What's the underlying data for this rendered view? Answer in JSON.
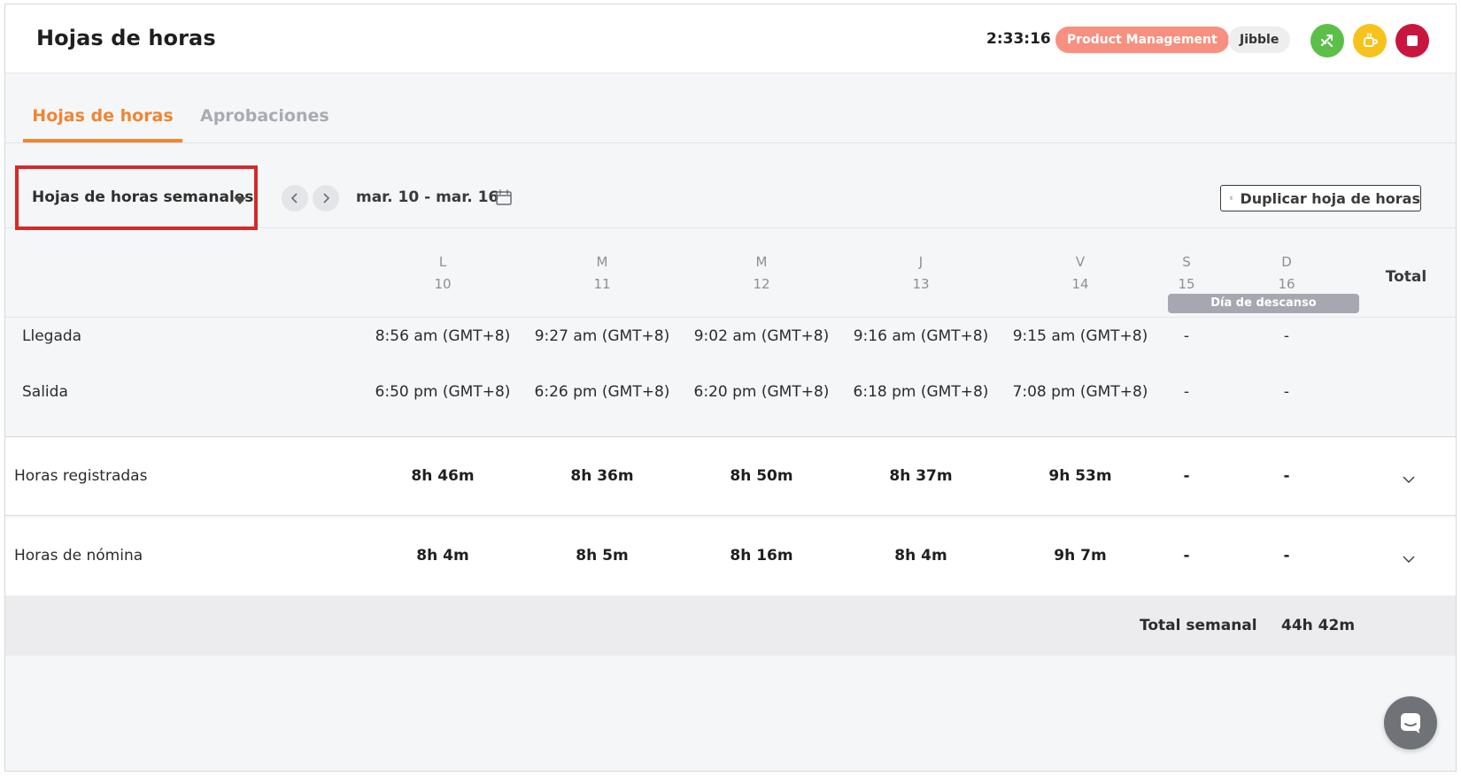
{
  "header": {
    "title": "Hojas de horas",
    "timer": "2:33:16",
    "project_badge": "Product Management",
    "org_badge": "Jibble",
    "actions": [
      "switch-icon",
      "coffee-break-icon",
      "stop-icon"
    ],
    "colors": {
      "switch": "#5cbf4a",
      "break": "#f7c21b",
      "stop": "#c8173e",
      "project_badge": "#f79080"
    }
  },
  "tabs": [
    {
      "label": "Hojas de horas",
      "active": true
    },
    {
      "label": "Aprobaciones",
      "active": false
    }
  ],
  "toolbar": {
    "view_selector": "Hojas de horas semanales",
    "date_range": "mar. 10 - mar. 16",
    "duplicate_label": "Duplicar hoja de horas"
  },
  "days": [
    {
      "letter": "L",
      "num": "10"
    },
    {
      "letter": "M",
      "num": "11"
    },
    {
      "letter": "M",
      "num": "12"
    },
    {
      "letter": "J",
      "num": "13"
    },
    {
      "letter": "V",
      "num": "14"
    },
    {
      "letter": "S",
      "num": "15"
    },
    {
      "letter": "D",
      "num": "16"
    }
  ],
  "total_header": "Total",
  "rest_day_label": "Día de descanso",
  "rows": {
    "arrival": {
      "label": "Llegada",
      "values": [
        "8:56 am (GMT+8)",
        "9:27 am (GMT+8)",
        "9:02 am (GMT+8)",
        "9:16 am (GMT+8)",
        "9:15 am (GMT+8)",
        "-",
        "-"
      ]
    },
    "departure": {
      "label": "Salida",
      "values": [
        "6:50 pm (GMT+8)",
        "6:26 pm (GMT+8)",
        "6:20 pm (GMT+8)",
        "6:18 pm (GMT+8)",
        "7:08 pm (GMT+8)",
        "-",
        "-"
      ]
    },
    "tracked": {
      "label": "Horas registradas",
      "values": [
        "8h 46m",
        "8h 36m",
        "8h 50m",
        "8h 37m",
        "9h 53m",
        "-",
        "-"
      ]
    },
    "payroll": {
      "label": "Horas de nómina",
      "values": [
        "8h 4m",
        "8h 5m",
        "8h 16m",
        "8h 4m",
        "9h 7m",
        "-",
        "-"
      ]
    }
  },
  "weekly_total": {
    "label": "Total semanal",
    "value": "44h 42m"
  },
  "accent_color": "#f08532"
}
